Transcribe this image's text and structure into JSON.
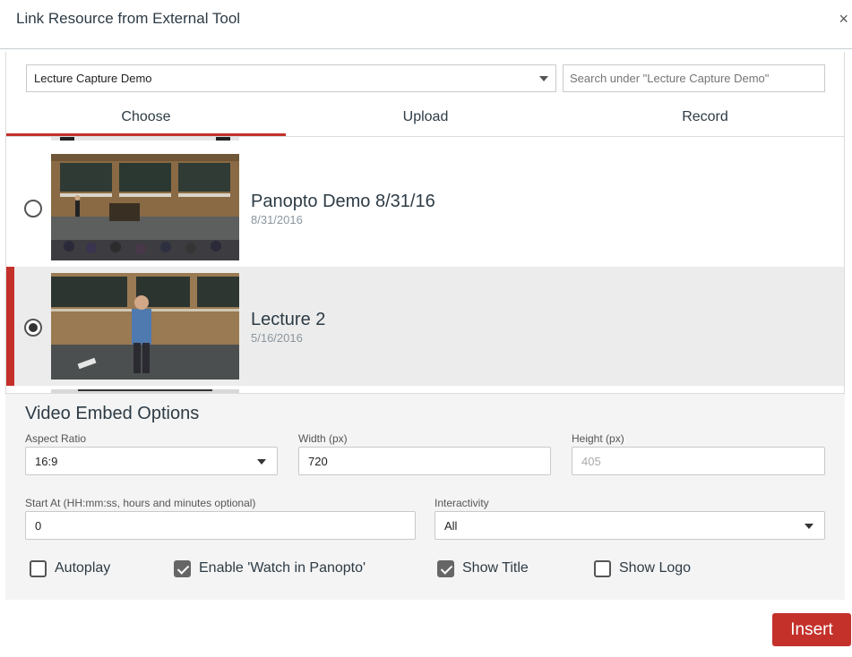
{
  "dialog": {
    "title": "Link Resource from External Tool",
    "close_icon": "×"
  },
  "folder": {
    "selected": "Lecture Capture Demo"
  },
  "search": {
    "placeholder": "Search under \"Lecture Capture Demo\""
  },
  "tabs": [
    {
      "label": "Choose",
      "active": true
    },
    {
      "label": "Upload",
      "active": false
    },
    {
      "label": "Record",
      "active": false
    }
  ],
  "videos": [
    {
      "title": "Panopto Demo 8/31/16",
      "date": "8/31/2016",
      "selected": false
    },
    {
      "title": "Lecture 2",
      "date": "5/16/2016",
      "selected": true
    }
  ],
  "embed_options": {
    "heading": "Video Embed Options",
    "aspect_ratio": {
      "label": "Aspect Ratio",
      "value": "16:9"
    },
    "width": {
      "label": "Width (px)",
      "value": "720"
    },
    "height": {
      "label": "Height (px)",
      "value": "405"
    },
    "start_at": {
      "label": "Start At (HH:mm:ss, hours and minutes optional)",
      "value": "0"
    },
    "interactivity": {
      "label": "Interactivity",
      "value": "All"
    },
    "checkboxes": [
      {
        "label": "Autoplay",
        "checked": false
      },
      {
        "label": "Enable 'Watch in Panopto'",
        "checked": true
      },
      {
        "label": "Show Title",
        "checked": true
      },
      {
        "label": "Show Logo",
        "checked": false
      }
    ]
  },
  "actions": {
    "insert_label": "Insert"
  },
  "colors": {
    "accent": "#c4312b",
    "text": "#2d3b45",
    "muted": "#8b969e"
  }
}
